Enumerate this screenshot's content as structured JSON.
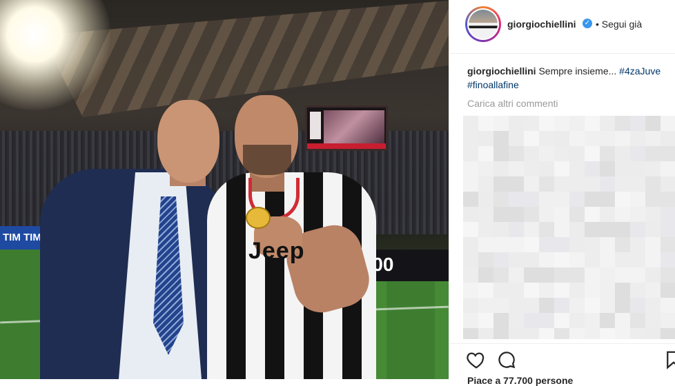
{
  "post": {
    "photo_texts": {
      "adboard": "TIM TIM CUP",
      "clock": "00",
      "sponsor": "Jeep"
    }
  },
  "header": {
    "username": "giorgiochiellini",
    "verified_icon": "verified-badge-icon",
    "follow_status": "• Segui già"
  },
  "caption": {
    "username": "giorgiochiellini",
    "text": "Sempre insieme...",
    "hashtags": [
      "#4zaJuve",
      "#finoallafine"
    ]
  },
  "comments": {
    "load_more": "Carica altri commenti"
  },
  "actions": {
    "icons": [
      "heart-icon",
      "comment-icon",
      "bookmark-icon"
    ],
    "likes": "Piace a 77.700 persone"
  },
  "colors": {
    "link": "#003569",
    "verified": "#3897f0",
    "muted": "#999999"
  }
}
